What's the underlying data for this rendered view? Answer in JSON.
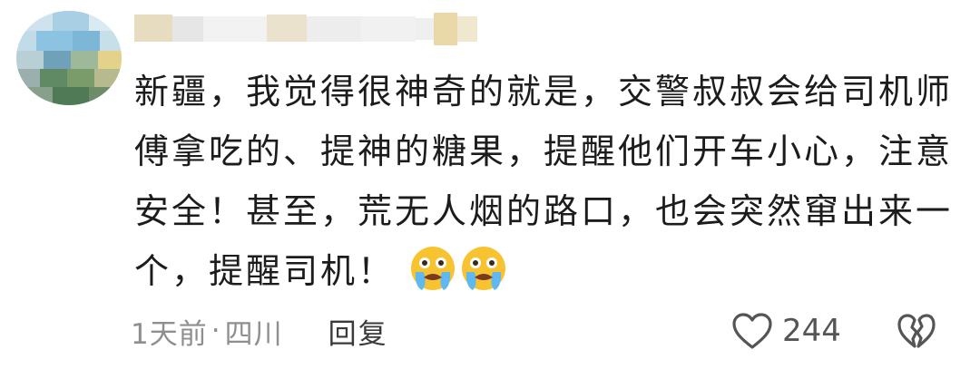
{
  "comment": {
    "lines": [
      "新疆，我觉得很神奇的就是，交警叔叔会给司机师",
      "傅拿吃的、提神的糖果，提醒他们开车小心，注意",
      "安全！甚至，荒无人烟的路口，也会突然窜出来一",
      "个，提醒司机！"
    ],
    "emojis": [
      "crying-face-icon",
      "crying-face-icon"
    ]
  },
  "footer": {
    "time": "1天前",
    "separator": "·",
    "location": "四川",
    "reply_label": "回复"
  },
  "actions": {
    "like_icon": "heart-outline-icon",
    "like_count": "244",
    "dislike_icon": "broken-heart-icon"
  },
  "colors": {
    "text": "#1c1c1c",
    "meta": "#8e8e8e",
    "emoji_face": "#f7c331"
  }
}
